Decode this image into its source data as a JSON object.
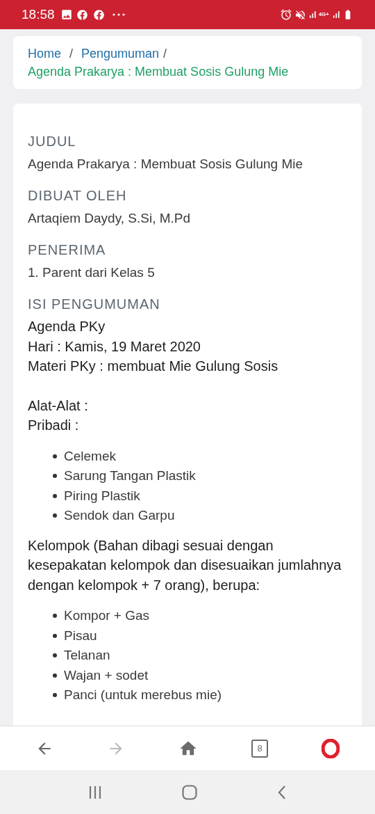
{
  "status_bar": {
    "time": "18:58",
    "network": "4G+"
  },
  "breadcrumb": [
    {
      "label": "Home",
      "selected": false
    },
    {
      "label": "Pengumuman",
      "selected": false
    },
    {
      "label": "Agenda Prakarya : Membuat Sosis Gulung Mie",
      "selected": true
    }
  ],
  "breadcrumb_separator": "/",
  "fields": [
    {
      "label": "JUDUL",
      "value": "Agenda Prakarya : Membuat Sosis Gulung Mie"
    },
    {
      "label": "DIBUAT OLEH",
      "value": "Artaqiem Daydy, S.Si, M.Pd"
    },
    {
      "label": "PENERIMA",
      "value": "1. Parent dari Kelas 5"
    }
  ],
  "content": {
    "label": "ISI PENGUMUMAN",
    "blocks": [
      {
        "kind": "lines",
        "lines": [
          "Agenda PKy",
          "Hari : Kamis, 19 Maret 2020",
          "Materi PKy : membuat Mie Gulung Sosis"
        ]
      },
      {
        "kind": "lines",
        "lines": [
          "Alat-Alat :",
          "Pribadi :"
        ]
      },
      {
        "kind": "list",
        "items": [
          "Celemek",
          "Sarung Tangan Plastik",
          "Piring Plastik",
          "Sendok dan Garpu"
        ]
      },
      {
        "kind": "lines",
        "lines": [
          "Kelompok (Bahan dibagi sesuai dengan kesepakatan kelompok dan disesuaikan jumlahnya dengan kelompok + 7 orang), berupa:"
        ]
      },
      {
        "kind": "list",
        "items": [
          "Kompor + Gas",
          "Pisau",
          "Telanan",
          "Wajan + sodet",
          "Panci (untuk merebus mie)"
        ]
      }
    ]
  },
  "browser_toolbar": {
    "back": {
      "disabled": false
    },
    "forward": {
      "disabled": true
    },
    "tab_count": "8"
  }
}
